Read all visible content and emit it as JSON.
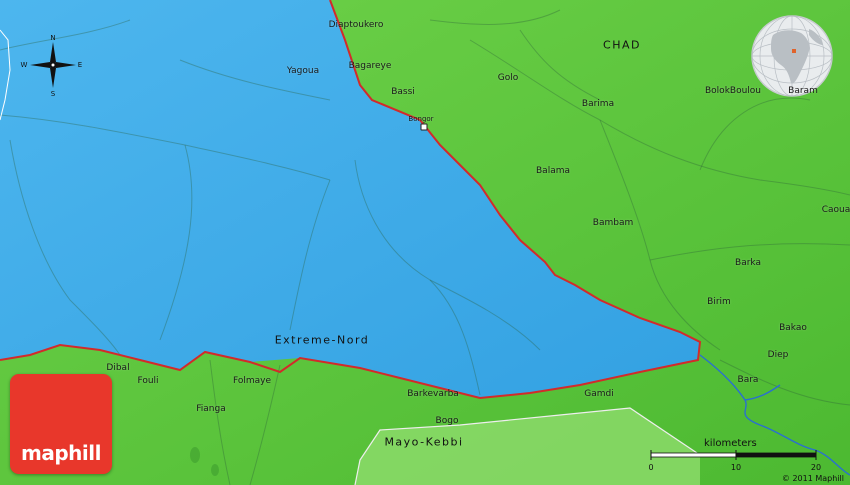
{
  "map": {
    "country_label": "CHAD",
    "regions": [
      {
        "id": "extreme-nord",
        "name": "Extreme-Nord"
      },
      {
        "id": "mayo-kebbi",
        "name": "Mayo-Kebbi"
      }
    ],
    "places": [
      {
        "id": "diaptoukero",
        "name": "Diaptoukero"
      },
      {
        "id": "yagoua",
        "name": "Yagoua"
      },
      {
        "id": "bagareye",
        "name": "Bagareye"
      },
      {
        "id": "bassi",
        "name": "Bassi"
      },
      {
        "id": "golo",
        "name": "Golo"
      },
      {
        "id": "bongor",
        "name": "Bongor"
      },
      {
        "id": "barima",
        "name": "Barima"
      },
      {
        "id": "bolokboulou",
        "name": "BolokBoulou"
      },
      {
        "id": "baram",
        "name": "Baram"
      },
      {
        "id": "balama",
        "name": "Balama"
      },
      {
        "id": "bambam",
        "name": "Bambam"
      },
      {
        "id": "caoua",
        "name": "Caoua"
      },
      {
        "id": "barka",
        "name": "Barka"
      },
      {
        "id": "birim",
        "name": "Birim"
      },
      {
        "id": "bakao",
        "name": "Bakao"
      },
      {
        "id": "diep",
        "name": "Diep"
      },
      {
        "id": "bara",
        "name": "Bara"
      },
      {
        "id": "dibal",
        "name": "Dibal"
      },
      {
        "id": "fouli",
        "name": "Fouli"
      },
      {
        "id": "folmaye",
        "name": "Folmaye"
      },
      {
        "id": "fianga",
        "name": "Fianga"
      },
      {
        "id": "barkevarba",
        "name": "Barkevarba"
      },
      {
        "id": "gamdi",
        "name": "Gamdi"
      },
      {
        "id": "bogo",
        "name": "Bogo"
      }
    ],
    "compass": {
      "n": "N",
      "s": "S",
      "e": "E",
      "w": "W"
    },
    "scale": {
      "title": "kilometers",
      "ticks": [
        "0",
        "10",
        "20"
      ]
    },
    "logo": "maphill",
    "copyright": "© 2011 Maphill",
    "colors": {
      "land": "#56c43a",
      "water": "#3aa7e6",
      "border": "#d32a2a",
      "river": "#2a6fd0"
    }
  }
}
